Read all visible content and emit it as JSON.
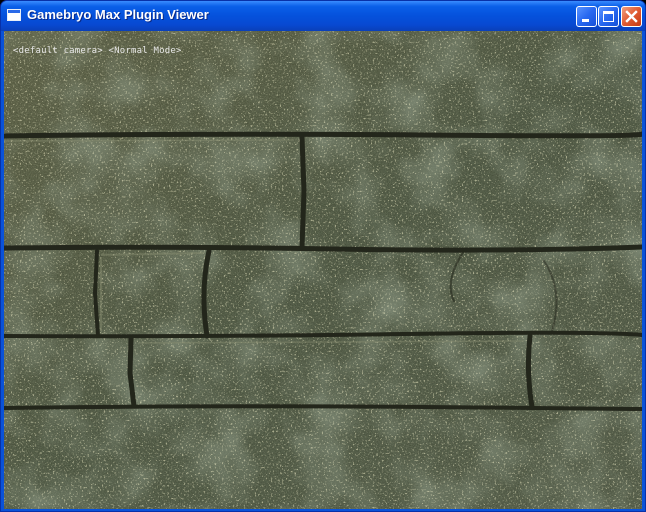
{
  "window": {
    "title": "Gamebryo Max Plugin Viewer",
    "icon": "application-window-icon",
    "controls": {
      "minimize": "minimize-icon",
      "maximize": "maximize-icon",
      "close": "close-icon"
    }
  },
  "viewport": {
    "hud_text": "<default camera> <Normal Mode>",
    "scene": "stone-brick-wall-texture"
  },
  "colors": {
    "titlebar": "#0551dc",
    "close_button": "#e05a32",
    "stone": "#5b6450",
    "mortar": "#24261c",
    "hud_text": "#e8e8e8"
  }
}
